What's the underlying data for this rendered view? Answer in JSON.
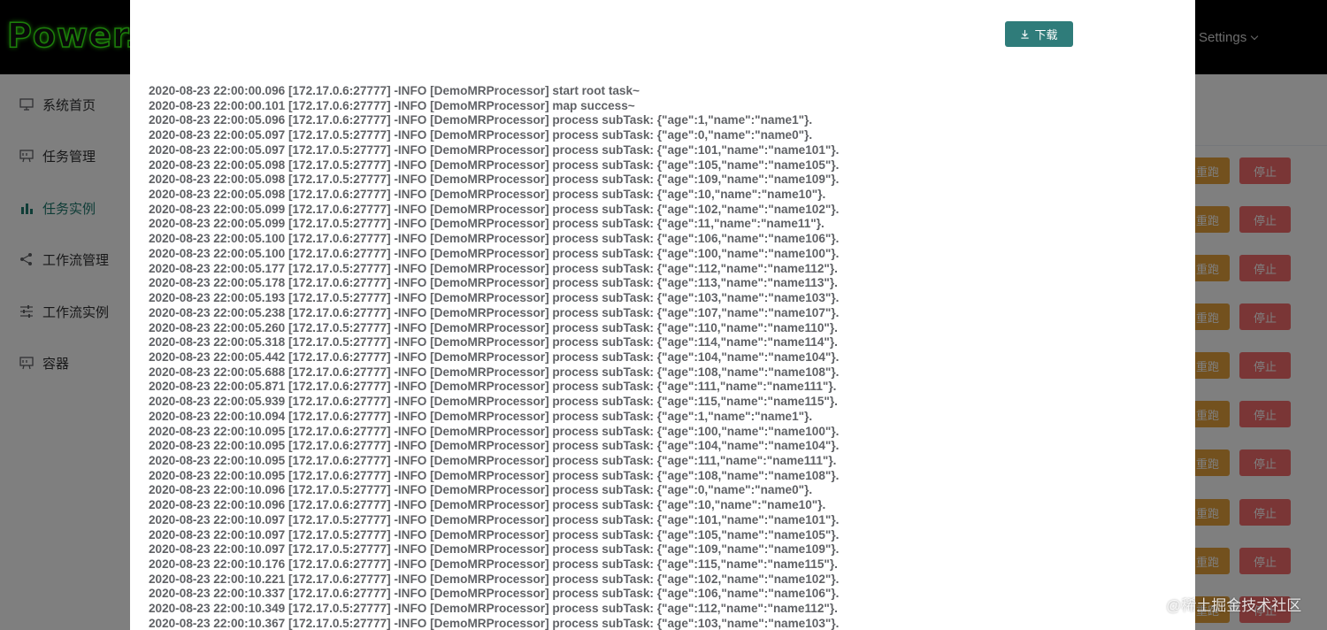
{
  "app": {
    "logo_text": "Power.",
    "settings_label": "Settings"
  },
  "sidebar": {
    "items": [
      {
        "label": "系统首页",
        "icon": "monitor-icon",
        "active": false
      },
      {
        "label": "任务管理",
        "icon": "task-icon",
        "active": false
      },
      {
        "label": "任务实例",
        "icon": "bar-chart-icon",
        "active": true
      },
      {
        "label": "工作流管理",
        "icon": "share-icon",
        "active": false
      },
      {
        "label": "工作流实例",
        "icon": "sliders-icon",
        "active": false
      },
      {
        "label": "容器",
        "icon": "container-icon",
        "active": false
      }
    ]
  },
  "table_actions": {
    "rerun_label": "重跑",
    "stop_label": "停止"
  },
  "dialog": {
    "download_label": "下载",
    "log_lines": [
      "2020-08-23 22:00:00.096 [172.17.0.6:27777] -INFO [DemoMRProcessor] start root task~",
      "2020-08-23 22:00:00.101 [172.17.0.6:27777] -INFO [DemoMRProcessor] map success~",
      "2020-08-23 22:00:05.096 [172.17.0.6:27777] -INFO [DemoMRProcessor] process subTask: {\"age\":1,\"name\":\"name1\"}.",
      "2020-08-23 22:00:05.097 [172.17.0.5:27777] -INFO [DemoMRProcessor] process subTask: {\"age\":0,\"name\":\"name0\"}.",
      "2020-08-23 22:00:05.097 [172.17.0.5:27777] -INFO [DemoMRProcessor] process subTask: {\"age\":101,\"name\":\"name101\"}.",
      "2020-08-23 22:00:05.098 [172.17.0.5:27777] -INFO [DemoMRProcessor] process subTask: {\"age\":105,\"name\":\"name105\"}.",
      "2020-08-23 22:00:05.098 [172.17.0.5:27777] -INFO [DemoMRProcessor] process subTask: {\"age\":109,\"name\":\"name109\"}.",
      "2020-08-23 22:00:05.098 [172.17.0.6:27777] -INFO [DemoMRProcessor] process subTask: {\"age\":10,\"name\":\"name10\"}.",
      "2020-08-23 22:00:05.099 [172.17.0.6:27777] -INFO [DemoMRProcessor] process subTask: {\"age\":102,\"name\":\"name102\"}.",
      "2020-08-23 22:00:05.099 [172.17.0.5:27777] -INFO [DemoMRProcessor] process subTask: {\"age\":11,\"name\":\"name11\"}.",
      "2020-08-23 22:00:05.100 [172.17.0.6:27777] -INFO [DemoMRProcessor] process subTask: {\"age\":106,\"name\":\"name106\"}.",
      "2020-08-23 22:00:05.100 [172.17.0.6:27777] -INFO [DemoMRProcessor] process subTask: {\"age\":100,\"name\":\"name100\"}.",
      "2020-08-23 22:00:05.177 [172.17.0.5:27777] -INFO [DemoMRProcessor] process subTask: {\"age\":112,\"name\":\"name112\"}.",
      "2020-08-23 22:00:05.178 [172.17.0.6:27777] -INFO [DemoMRProcessor] process subTask: {\"age\":113,\"name\":\"name113\"}.",
      "2020-08-23 22:00:05.193 [172.17.0.5:27777] -INFO [DemoMRProcessor] process subTask: {\"age\":103,\"name\":\"name103\"}.",
      "2020-08-23 22:00:05.238 [172.17.0.6:27777] -INFO [DemoMRProcessor] process subTask: {\"age\":107,\"name\":\"name107\"}.",
      "2020-08-23 22:00:05.260 [172.17.0.5:27777] -INFO [DemoMRProcessor] process subTask: {\"age\":110,\"name\":\"name110\"}.",
      "2020-08-23 22:00:05.318 [172.17.0.5:27777] -INFO [DemoMRProcessor] process subTask: {\"age\":114,\"name\":\"name114\"}.",
      "2020-08-23 22:00:05.442 [172.17.0.6:27777] -INFO [DemoMRProcessor] process subTask: {\"age\":104,\"name\":\"name104\"}.",
      "2020-08-23 22:00:05.688 [172.17.0.6:27777] -INFO [DemoMRProcessor] process subTask: {\"age\":108,\"name\":\"name108\"}.",
      "2020-08-23 22:00:05.871 [172.17.0.6:27777] -INFO [DemoMRProcessor] process subTask: {\"age\":111,\"name\":\"name111\"}.",
      "2020-08-23 22:00:05.939 [172.17.0.6:27777] -INFO [DemoMRProcessor] process subTask: {\"age\":115,\"name\":\"name115\"}.",
      "2020-08-23 22:00:10.094 [172.17.0.6:27777] -INFO [DemoMRProcessor] process subTask: {\"age\":1,\"name\":\"name1\"}.",
      "2020-08-23 22:00:10.095 [172.17.0.6:27777] -INFO [DemoMRProcessor] process subTask: {\"age\":100,\"name\":\"name100\"}.",
      "2020-08-23 22:00:10.095 [172.17.0.6:27777] -INFO [DemoMRProcessor] process subTask: {\"age\":104,\"name\":\"name104\"}.",
      "2020-08-23 22:00:10.095 [172.17.0.6:27777] -INFO [DemoMRProcessor] process subTask: {\"age\":111,\"name\":\"name111\"}.",
      "2020-08-23 22:00:10.095 [172.17.0.6:27777] -INFO [DemoMRProcessor] process subTask: {\"age\":108,\"name\":\"name108\"}.",
      "2020-08-23 22:00:10.096 [172.17.0.5:27777] -INFO [DemoMRProcessor] process subTask: {\"age\":0,\"name\":\"name0\"}.",
      "2020-08-23 22:00:10.096 [172.17.0.6:27777] -INFO [DemoMRProcessor] process subTask: {\"age\":10,\"name\":\"name10\"}.",
      "2020-08-23 22:00:10.097 [172.17.0.5:27777] -INFO [DemoMRProcessor] process subTask: {\"age\":101,\"name\":\"name101\"}.",
      "2020-08-23 22:00:10.097 [172.17.0.5:27777] -INFO [DemoMRProcessor] process subTask: {\"age\":105,\"name\":\"name105\"}.",
      "2020-08-23 22:00:10.097 [172.17.0.5:27777] -INFO [DemoMRProcessor] process subTask: {\"age\":109,\"name\":\"name109\"}.",
      "2020-08-23 22:00:10.176 [172.17.0.6:27777] -INFO [DemoMRProcessor] process subTask: {\"age\":115,\"name\":\"name115\"}.",
      "2020-08-23 22:00:10.221 [172.17.0.6:27777] -INFO [DemoMRProcessor] process subTask: {\"age\":102,\"name\":\"name102\"}.",
      "2020-08-23 22:00:10.337 [172.17.0.6:27777] -INFO [DemoMRProcessor] process subTask: {\"age\":106,\"name\":\"name106\"}.",
      "2020-08-23 22:00:10.349 [172.17.0.5:27777] -INFO [DemoMRProcessor] process subTask: {\"age\":112,\"name\":\"name112\"}.",
      "2020-08-23 22:00:10.367 [172.17.0.5:27777] -INFO [DemoMRProcessor] process subTask: {\"age\":103,\"name\":\"name103\"}."
    ]
  },
  "watermark_text": "@稀土掘金技术社区"
}
